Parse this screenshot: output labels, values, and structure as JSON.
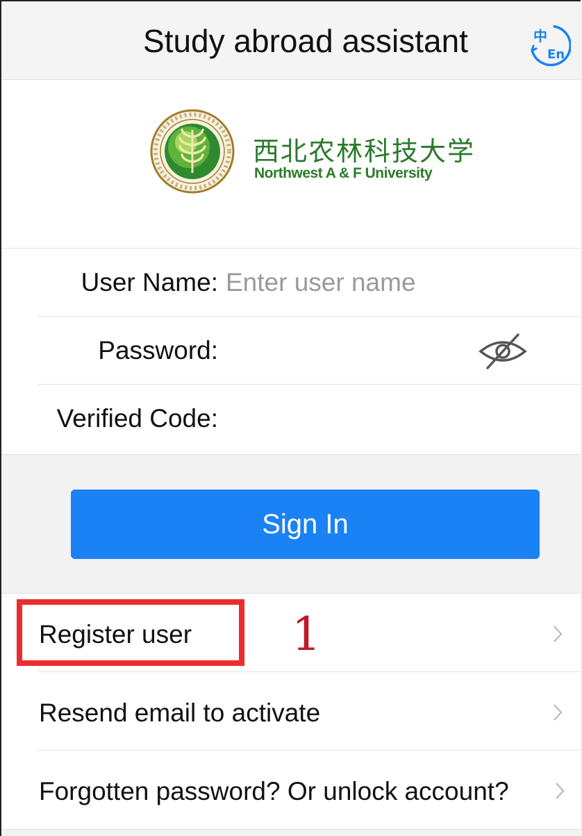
{
  "header": {
    "title": "Study abroad assistant",
    "lang_icon_label": "中 En",
    "lang_icon": "language-switch-icon"
  },
  "logo": {
    "chinese_name": "西北农林科技大学",
    "english_name": "Northwest A & F University",
    "emblem_icon": "university-emblem-icon"
  },
  "form": {
    "username_label": "User Name:",
    "username_placeholder": "Enter user name",
    "username_value": "",
    "password_label": "Password:",
    "password_value": "",
    "password_toggle_icon": "eye-hidden-icon",
    "code_label": "Verified Code:",
    "code_value": ""
  },
  "signin": {
    "label": "Sign In"
  },
  "links": [
    {
      "label": "Register user"
    },
    {
      "label": "Resend email to activate"
    },
    {
      "label": "Forgotten password? Or unlock account?"
    }
  ],
  "annotation": {
    "step": "1"
  },
  "colors": {
    "accent": "#1a82f5",
    "brand_green": "#2a7a2a",
    "highlight_red": "#ec2d2d",
    "step_red": "#c0182a"
  }
}
